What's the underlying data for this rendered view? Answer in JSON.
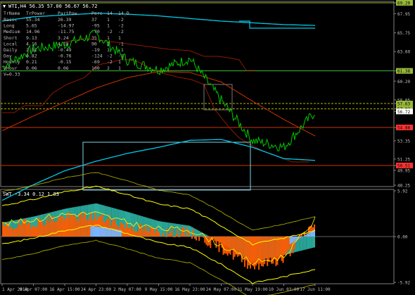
{
  "main_panel": {
    "title": "WTI,H4  56.35 57.00 56.67 56.72",
    "info_table": {
      "headers": [
        "TrName",
        "TrPower",
        "PartPow",
        "Perc",
        "14",
        "14_D"
      ],
      "rows": [
        [
          "Basic",
          "55.34",
          "26.39",
          "37",
          "1",
          "-2"
        ],
        [
          "Long",
          "5.65",
          "-14.97",
          "-95",
          "1",
          "-2"
        ],
        [
          "Medium",
          "14.96",
          "-11.75",
          "-70",
          "-2",
          "-2"
        ],
        [
          "Short",
          "9.13",
          "3.24",
          "35",
          "1",
          "1"
        ],
        [
          "Local",
          "4.16",
          "4.18",
          "90",
          "2",
          "-1"
        ],
        [
          "Daily",
          "2.51",
          "-0.49",
          "-19",
          "1",
          "-1"
        ],
        [
          "Day",
          "0.82",
          "-0.76",
          "-124",
          "-2",
          "-1"
        ],
        [
          "Hourly",
          "0.21",
          "-0.15",
          "-69",
          "-2",
          "1"
        ],
        [
          "1Hour",
          "0.06",
          "0.06",
          "100",
          "2",
          "1"
        ]
      ],
      "footer": "V=0.33"
    },
    "price_labels": [
      "69.20",
      "67.95",
      "65.75",
      "63.60",
      "61.38",
      "60.20",
      "58.05",
      "57.63",
      "57.02",
      "56.72",
      "54.88",
      "53.35",
      "51.25",
      "50.51",
      "49.95",
      "48.25"
    ],
    "highlighted_labels": [
      {
        "text": "69.20",
        "bg": "#98b83a"
      },
      {
        "text": "61.38",
        "bg": "#98b83a"
      },
      {
        "text": "57.63",
        "bg": "#98b83a"
      },
      {
        "text": "57.02",
        "bg": "#98b83a"
      },
      {
        "text": "56.72",
        "bg": "#ffffff"
      },
      {
        "text": "54.88",
        "bg": "#ff3333"
      },
      {
        "text": "50.51",
        "bg": "#ff3333"
      }
    ]
  },
  "sub_panel": {
    "title": "SWT -3.34 0.12 1.83",
    "scale_labels": [
      "5.92",
      "0.00",
      "-5.92"
    ]
  },
  "time_axis": {
    "labels": [
      "1 Apr 2019",
      "9 Apr 07:00",
      "16 Apr 15:00",
      "24 Apr 23:00",
      "2 May 07:00",
      "9 May 15:00",
      "16 May 23:00",
      "24 May 07:00",
      "31 May 19:00",
      "10 Jun 03:00",
      "17 Jun 11:00"
    ]
  },
  "colors": {
    "background": "#000000",
    "price": "#00c800",
    "cyan_line": "#00c8e6",
    "red_line": "#cc3300",
    "yellow_line": "#ffff00",
    "teal_hist": "#2aa89a",
    "orange_hist": "#ff5a00",
    "blue_hist": "#7ab4ff",
    "olive_line": "#b5b500",
    "green_level": "#3cbc3c"
  },
  "chart_data": [
    {
      "type": "line",
      "title": "WTI,H4  56.35 57.00 56.67 56.72",
      "x": [
        "1 Apr 2019",
        "9 Apr 07:00",
        "16 Apr 15:00",
        "24 Apr 23:00",
        "2 May 07:00",
        "9 May 15:00",
        "16 May 23:00",
        "24 May 07:00",
        "31 May 19:00",
        "10 Jun 03:00",
        "17 Jun 11:00"
      ],
      "ylim": [
        48.25,
        69.2
      ],
      "series": [
        {
          "values": [
            61.8,
            63.9,
            64.4,
            65.6,
            62.6,
            61.5,
            62.8,
            58.0,
            53.4,
            52.6,
            56.7
          ]
        },
        {
          "values": [
            54.5,
            56.2,
            57.8,
            59.4,
            60.6,
            61.3,
            61.2,
            60.1,
            57.9,
            55.8,
            53.9
          ]
        },
        {
          "values": [
            46.5,
            48.3,
            49.9,
            51.0,
            51.9,
            52.6,
            53.4,
            53.5,
            52.6,
            51.3,
            51.1
          ]
        },
        {
          "values": [
            67.1,
            67.6,
            67.8,
            68.0,
            67.9,
            67.7,
            67.4,
            67.1,
            66.9,
            66.7,
            66.6
          ]
        }
      ],
      "levels": [
        61.38,
        57.63,
        57.02,
        54.88,
        50.51,
        69.2
      ],
      "grid": false
    },
    {
      "type": "area",
      "title": "SWT -3.34 0.12 1.83",
      "x": [
        "1 Apr 2019",
        "9 Apr 07:00",
        "16 Apr 15:00",
        "24 Apr 23:00",
        "2 May 07:00",
        "9 May 15:00",
        "16 May 23:00",
        "24 May 07:00",
        "31 May 19:00",
        "10 Jun 03:00",
        "17 Jun 11:00"
      ],
      "ylim": [
        -5.92,
        5.92
      ],
      "series": [
        {
          "values": [
            1.8,
            2.6,
            3.6,
            4.3,
            3.2,
            2.0,
            1.4,
            -0.8,
            -3.2,
            -2.4,
            -1.4
          ]
        },
        {
          "values": [
            1.2,
            1.8,
            2.5,
            2.6,
            1.4,
            0.6,
            0.5,
            -1.5,
            -3.8,
            -3.0,
            1.8
          ]
        }
      ],
      "grid": false
    }
  ]
}
